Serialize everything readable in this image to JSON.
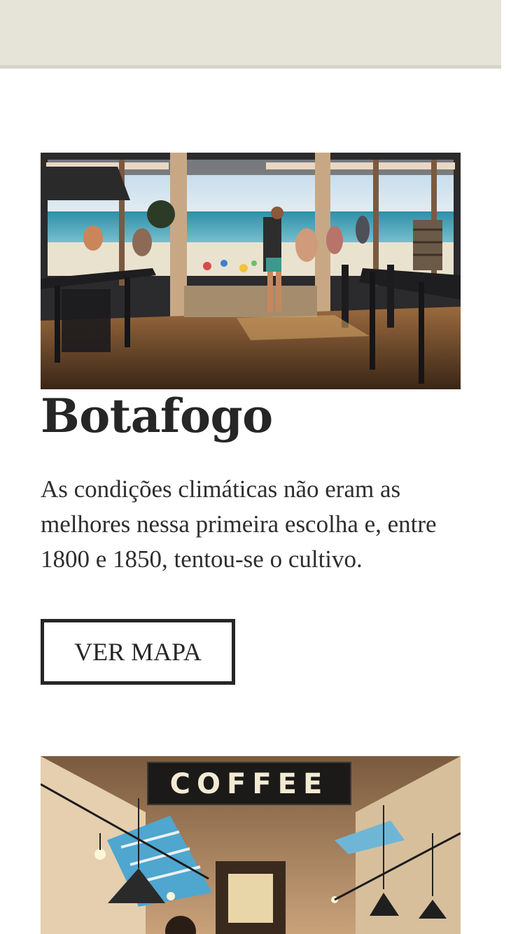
{
  "header": {},
  "places": [
    {
      "title": "Botafogo",
      "image_description_icon": "beach-cafe-photo",
      "description": "As condições climáticas não eram as melhores nessa primeira escolha e, entre 1800 e 1850, tentou-se o cultivo.",
      "button_label": "VER MAPA"
    },
    {
      "image_description_icon": "coffee-shop-photo",
      "sign_text": "COFFEE"
    }
  ],
  "colors": {
    "header_bg": "#e6e4d8",
    "text": "#262626",
    "button_border": "#262626"
  }
}
